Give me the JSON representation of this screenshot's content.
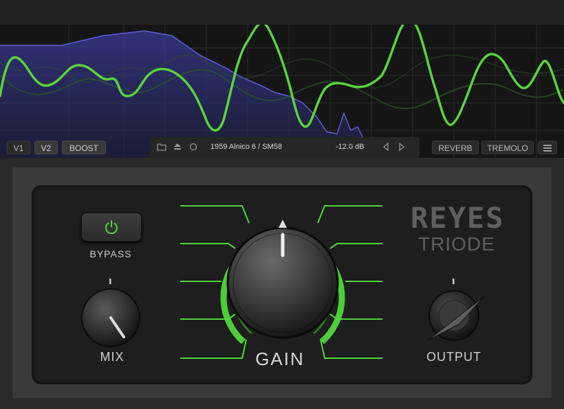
{
  "toolbar": {
    "v1_label": "V1",
    "v2_label": "V2",
    "boost_label": "BOOST",
    "reverb_label": "REVERB",
    "tremolo_label": "TREMOLO"
  },
  "preset": {
    "name": "1959 Alnico 6 / SM58",
    "level": "-12.0 dB"
  },
  "controls": {
    "bypass_label": "BYPASS",
    "mix_label": "MIX",
    "gain_label": "GAIN",
    "output_label": "OUTPUT"
  },
  "logo": {
    "line1": "REYES",
    "line2": "TRIODE"
  },
  "colors": {
    "accent_green": "#4fd83a",
    "spectrum_blue": "#5d5fd8",
    "panel_bg": "#1e1e1e"
  },
  "icons": [
    "folder-icon",
    "save-icon",
    "circle-icon",
    "prev-arrow-icon",
    "next-arrow-icon",
    "menu-icon",
    "power-icon"
  ]
}
